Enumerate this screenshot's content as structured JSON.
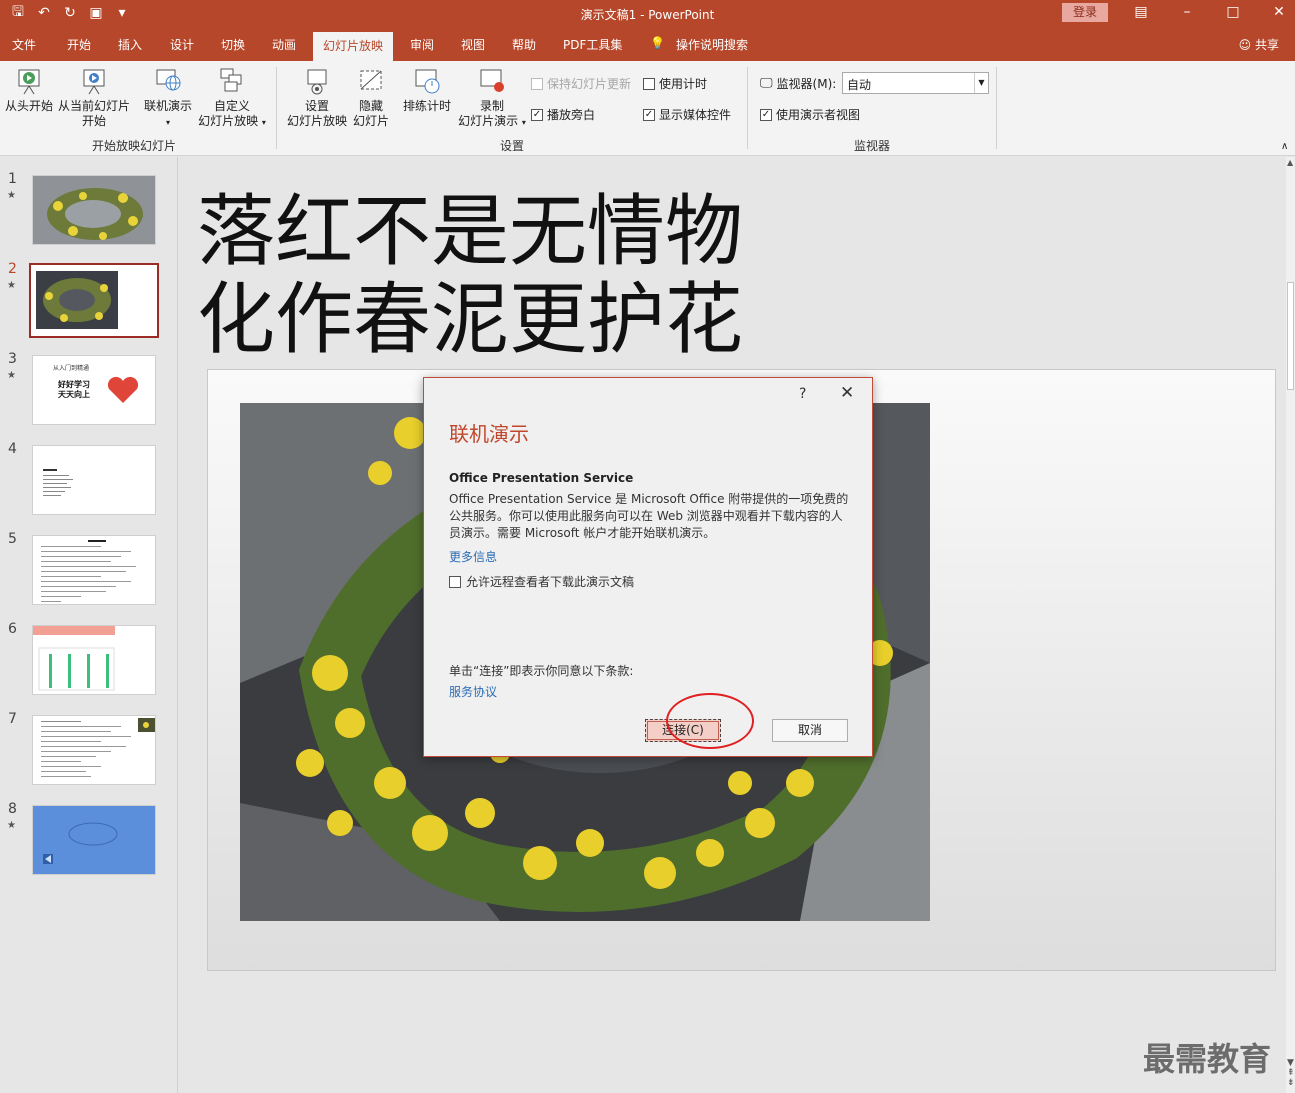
{
  "window": {
    "title": "演示文稿1 - PowerPoint",
    "login_label": "登录",
    "share_label": "共享"
  },
  "tabs": [
    "文件",
    "开始",
    "插入",
    "设计",
    "切换",
    "动画",
    "幻灯片放映",
    "审阅",
    "视图",
    "帮助",
    "PDF工具集",
    "操作说明搜索"
  ],
  "ribbon": {
    "from_beginning": "从头开始",
    "from_current_1": "从当前幻灯片",
    "from_current_2": "开始",
    "present_online": "联机演示",
    "custom_show_1": "自定义",
    "custom_show_2": "幻灯片放映",
    "group_start": "开始放映幻灯片",
    "setup_1": "设置",
    "setup_2": "幻灯片放映",
    "hide_1": "隐藏",
    "hide_2": "幻灯片",
    "rehearse": "排练计时",
    "record_1": "录制",
    "record_2": "幻灯片演示",
    "keep_updated": "保持幻灯片更新",
    "use_timings": "使用计时",
    "play_narrations": "播放旁白",
    "show_media_controls": "显示媒体控件",
    "group_setup": "设置",
    "monitor_label": "监视器(M):",
    "monitor_value": "自动",
    "presenter_view": "使用演示者视图",
    "group_monitors": "监视器"
  },
  "slides": {
    "numbers": [
      "1",
      "2",
      "3",
      "4",
      "5",
      "6",
      "7",
      "8"
    ],
    "thumb3_line1": "从入门到精通",
    "thumb3_line2": "好好学习",
    "thumb3_line3": "天天向上"
  },
  "slide": {
    "title_line1": "落红不是无情物",
    "title_line2": "化作春泥更护花"
  },
  "dialog": {
    "help": "?",
    "close": "✕",
    "title": "联机演示",
    "subtitle": "Office Presentation Service",
    "description": "Office Presentation Service 是 Microsoft Office 附带提供的一项免费的公共服务。你可以使用此服务向可以在 Web 浏览器中观看并下载内容的人员演示。需要 Microsoft 帐户才能开始联机演示。",
    "more_info": "更多信息",
    "allow_download": "允许远程查看者下载此演示文稿",
    "terms": "单击“连接”即表示你同意以下条款:",
    "service_agreement": "服务协议",
    "connect": "连接(C)",
    "cancel": "取消"
  },
  "watermark": "最需教育"
}
